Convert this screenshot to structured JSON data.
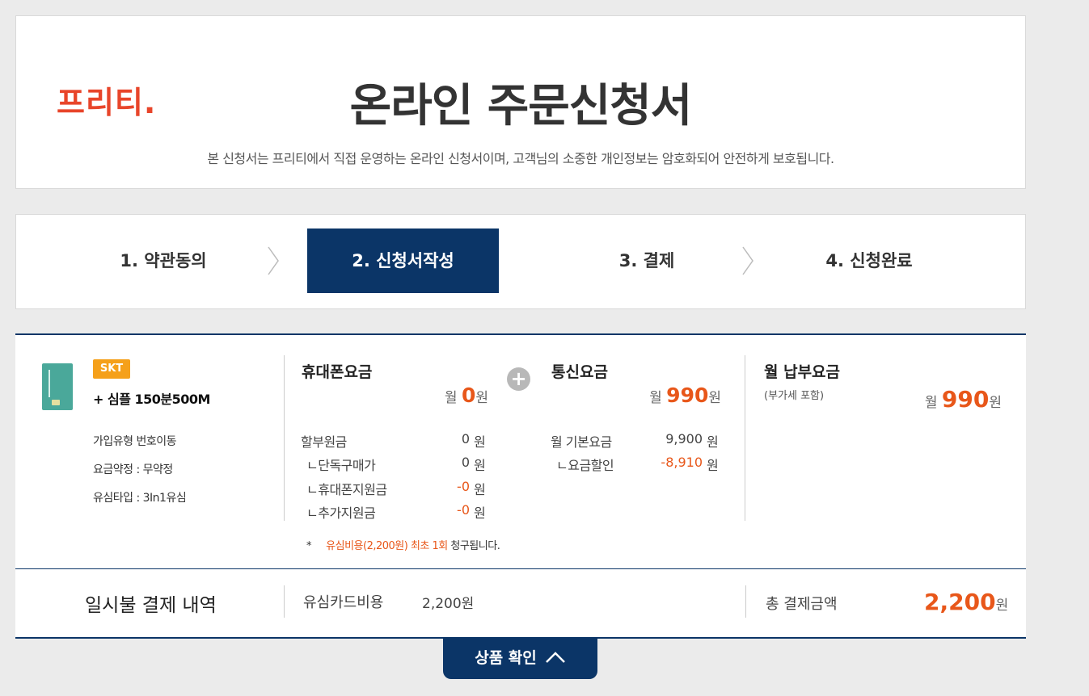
{
  "header": {
    "logo": "프리티.",
    "title": "온라인 주문신청서",
    "description": "본 신청서는 프리티에서 직접 운영하는 온라인 신청서이며, 고객님의 소중한 개인정보는 암호화되어 안전하게 보호됩니다."
  },
  "steps": [
    {
      "label": "1. 약관동의",
      "active": false
    },
    {
      "label": "2. 신청서작성",
      "active": true
    },
    {
      "label": "3. 결제",
      "active": false
    },
    {
      "label": "4. 신청완료",
      "active": false
    }
  ],
  "product": {
    "carrier": "SKT",
    "plan_name": "+ 심플 150분500M",
    "join_type": "가입유형  번호이동",
    "contract": "요금약정 :  무약정",
    "sim_type": "유심타입 :  3In1유심"
  },
  "phone_fee": {
    "title": "휴대폰요금",
    "prefix": "월",
    "amount": "0",
    "suffix": "원",
    "rows": [
      {
        "label": "할부원금",
        "value": "0",
        "unit": "원",
        "negative": false
      },
      {
        "label": "ㄴ단독구매가",
        "value": "0",
        "unit": "원",
        "negative": false
      },
      {
        "label": "ㄴ휴대폰지원금",
        "value": "-0",
        "unit": "원",
        "negative": true
      },
      {
        "label": "ㄴ추가지원금",
        "value": "-0",
        "unit": "원",
        "negative": true
      }
    ]
  },
  "comm_fee": {
    "title": "통신요금",
    "prefix": "월",
    "amount": "990",
    "suffix": "원",
    "rows": [
      {
        "label": "월 기본요금",
        "value": "9,900",
        "unit": "원",
        "negative": false
      },
      {
        "label": "ㄴ요금할인",
        "value": "-8,910",
        "unit": "원",
        "negative": true
      }
    ]
  },
  "monthly_total": {
    "title": "월 납부요금",
    "subtitle": "(부가세 포함)",
    "prefix": "월",
    "amount": "990",
    "suffix": "원"
  },
  "note": {
    "star": "*",
    "highlight": "유심비용(2,200원) 최초 1회",
    "rest": "청구됩니다."
  },
  "one_time": {
    "title": "일시불 결제 내역",
    "sim_label": "유심카드비용",
    "sim_value": "2,200원",
    "total_label": "총 결제금액",
    "total_amount": "2,200",
    "total_suffix": "원"
  },
  "confirm_button": "상품 확인",
  "colors": {
    "brand": "#e8452a",
    "navy": "#0b3567",
    "accent": "#e8571a",
    "badge": "#f5a01a"
  },
  "icons": {
    "step_separator": "chevron-right-icon",
    "plus": "plus-circle-icon",
    "confirm": "chevron-up-icon"
  }
}
